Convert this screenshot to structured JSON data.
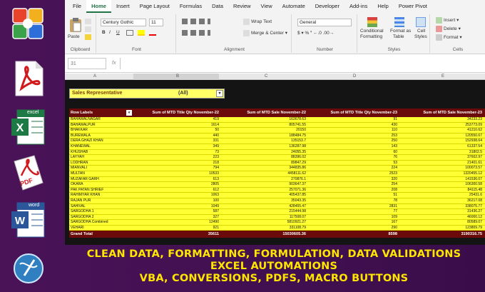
{
  "colors": {
    "accent": "#217346",
    "pivot_header": "#6b0a0a",
    "pivot_row": "#ffff33",
    "banner_text": "#ffe600",
    "background": "#4a1358"
  },
  "icons": {
    "office": "office-icon",
    "pdf": "pdf-icon",
    "excel": "excel-icon",
    "pdf_page": "pdf-page-icon",
    "word": "word-icon",
    "globe": "globe-icon"
  },
  "icon_labels": {
    "excel": "excel",
    "pdf_page": "PDF",
    "word": "word"
  },
  "menu": [
    "File",
    "Home",
    "Insert",
    "Page Layout",
    "Formulas",
    "Data",
    "Review",
    "View",
    "Automate",
    "Developer",
    "Add-ins",
    "Help",
    "Power Pivot"
  ],
  "ribbon": {
    "clipboard": {
      "paste": "Paste",
      "label": "Clipboard"
    },
    "font": {
      "family": "Century Gothic",
      "size": "11",
      "bold": "B",
      "italic": "I",
      "underline": "U",
      "label": "Font"
    },
    "alignment": {
      "wrap": "Wrap Text",
      "merge": "Merge & Center",
      "label": "Alignment"
    },
    "number": {
      "format": "General",
      "label": "Number"
    },
    "styles": {
      "conditional": "Conditional",
      "conditional2": "Formatting",
      "format_as": "Format as",
      "format_as2": "Table",
      "cell": "Cell",
      "cell2": "Styles",
      "label": "Styles"
    },
    "cells": {
      "insert": "Insert",
      "delete": "Delete",
      "format": "Format",
      "label": "Cells"
    }
  },
  "name_box": "31",
  "fx_label": "fx",
  "columns": [
    "A",
    "B",
    "C",
    "D",
    "E"
  ],
  "filter": {
    "label": "Sales Representative",
    "value": "(All)"
  },
  "pivot": {
    "headers": [
      "Row Labels",
      "Sum of  MTD Title Qty November-22",
      "Sum of MTD Sale  November-22",
      "Sum of  MTD Title Qty November-23",
      "Sum of MTD Sale  November-23"
    ],
    "rows": [
      [
        "BAHAWALNAGAR",
        "419",
        "163678.63",
        "91",
        "34233.23"
      ],
      [
        "BAHAWALPUR",
        "1614",
        "805741.55",
        "430",
        "253773.09"
      ],
      [
        "BHAKKAR",
        "50",
        "20150",
        "110",
        "41210.62"
      ],
      [
        "BUREWALA",
        "440",
        "188484.75",
        "253",
        "120550.67"
      ],
      [
        "DERA GHAZI KHAN",
        "331",
        "135153.7",
        "250",
        "152938.64"
      ],
      [
        "KHANEWAL",
        "349",
        "136287.98",
        "143",
        "61337.54"
      ],
      [
        "KHUSHAB",
        "73",
        "24055.35",
        "60",
        "31802.5"
      ],
      [
        "LAYYAH",
        "223",
        "88396.02",
        "76",
        "37602.97"
      ],
      [
        "LODHRAN",
        "218",
        "89847.29",
        "53",
        "21401.61"
      ],
      [
        "MIANVALI",
        "794",
        "344835.86",
        "224",
        "100073.57"
      ],
      [
        "MULTAN",
        "10533",
        "4458111.62",
        "2523",
        "1320455.12"
      ],
      [
        "MUZAFAR GARH",
        "613",
        "270876.1",
        "320",
        "141536.07"
      ],
      [
        "OKARA",
        "2805",
        "903647.37",
        "254",
        "106300.58"
      ],
      [
        "PAK PATAN SHRIEF",
        "612",
        "257071.36",
        "208",
        "84115.48"
      ],
      [
        "RAHIMYAR KHAN",
        "1063",
        "405437.85",
        "51",
        "25431.6"
      ],
      [
        "RAJAN PUR",
        "100",
        "35043.35",
        "78",
        "36217.08"
      ],
      [
        "SAHIVAL",
        "1049",
        "428455.47",
        "2831",
        "338075.77"
      ],
      [
        "SARGODHA 1",
        "587",
        "215444.98",
        "77",
        "31436.27"
      ],
      [
        "SARGODHA 2",
        "327",
        "117508.07",
        "109",
        "46000.12"
      ],
      [
        "SARGODHA Combined",
        "12490",
        "5810921.27",
        "167",
        "80589.07"
      ],
      [
        "VEHARI",
        "921",
        "331108.79",
        "290",
        "123809.79"
      ]
    ],
    "total": [
      "Grand Total",
      "35611",
      "15030605.36",
      "8598",
      "3190316.75"
    ]
  },
  "banner": [
    "CLEAN DATA, FORMATTING, FORMULATION, DATA VALIDATIONS",
    "EXCEL AUTOMATIONS",
    "VBA, CONVERSIONS, PDFS, MACRO BUTTONS"
  ]
}
